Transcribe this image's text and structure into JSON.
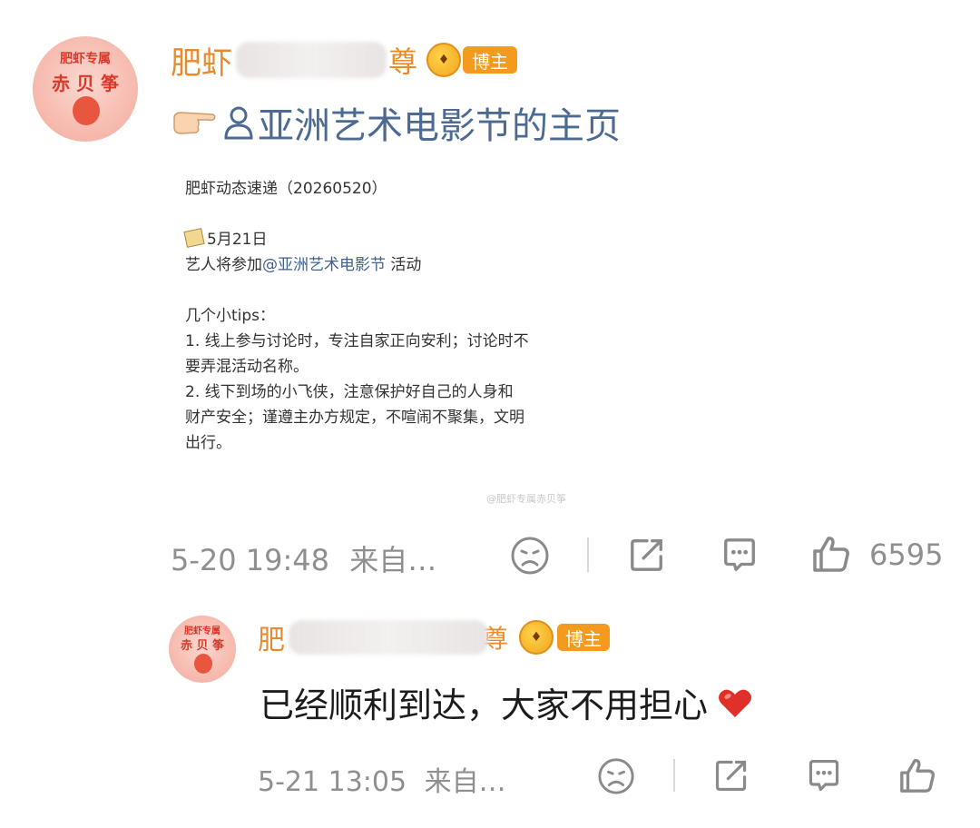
{
  "post": {
    "author": {
      "name_prefix": "肥虾",
      "name_suffix": "尊",
      "role_badge": "博主",
      "avatar_text_top": "肥虾专属",
      "avatar_text_mid": "赤 贝 筝"
    },
    "link_text": "亚洲艺术电影节的主页",
    "card": {
      "line1": "肥虾动态速递（20260520）",
      "date_line": "5月21日",
      "activity_prefix": "艺人将参加",
      "mention": "@亚洲艺术电影节",
      "activity_suffix": " 活动",
      "tips_title": "几个小tips：",
      "tip1_a": "1. 线上参与讨论时，专注自家正向安利；讨论时不",
      "tip1_b": "要弄混活动名称。",
      "tip2_a": "2. 线下到场的小飞侠，注意保护好自己的人身和",
      "tip2_b": "财产安全；谨遵主办方规定，不喧闹不聚集，文明",
      "tip2_c": "出行。",
      "watermark": "@肥虾专属赤贝筝"
    },
    "meta": {
      "time": "5-20 19:48",
      "source": "来自…",
      "like_count": "6595"
    }
  },
  "reply": {
    "author": {
      "name_prefix": "肥",
      "name_suffix": "尊",
      "role_badge": "博主",
      "avatar_text_top": "肥虾专属",
      "avatar_text_mid": "赤 贝 筝"
    },
    "text": "已经顺利到达，大家不用担心",
    "meta": {
      "time": "5-21 13:05",
      "source": "来自…"
    }
  },
  "icons": {
    "reaction": "sad-face-icon",
    "share": "share-icon",
    "comment": "comment-icon",
    "like": "thumbs-up-icon",
    "pointing": "pointing-hand-icon",
    "person": "person-icon",
    "heart": "red-heart-icon",
    "memo": "memo-icon"
  },
  "colors": {
    "name": "#e98a2e",
    "link": "#4d6b92",
    "mention": "#3f5f8f",
    "badge": "#f39a1f",
    "meta_gray": "#8f8f8f",
    "heart": "#e0302a"
  }
}
